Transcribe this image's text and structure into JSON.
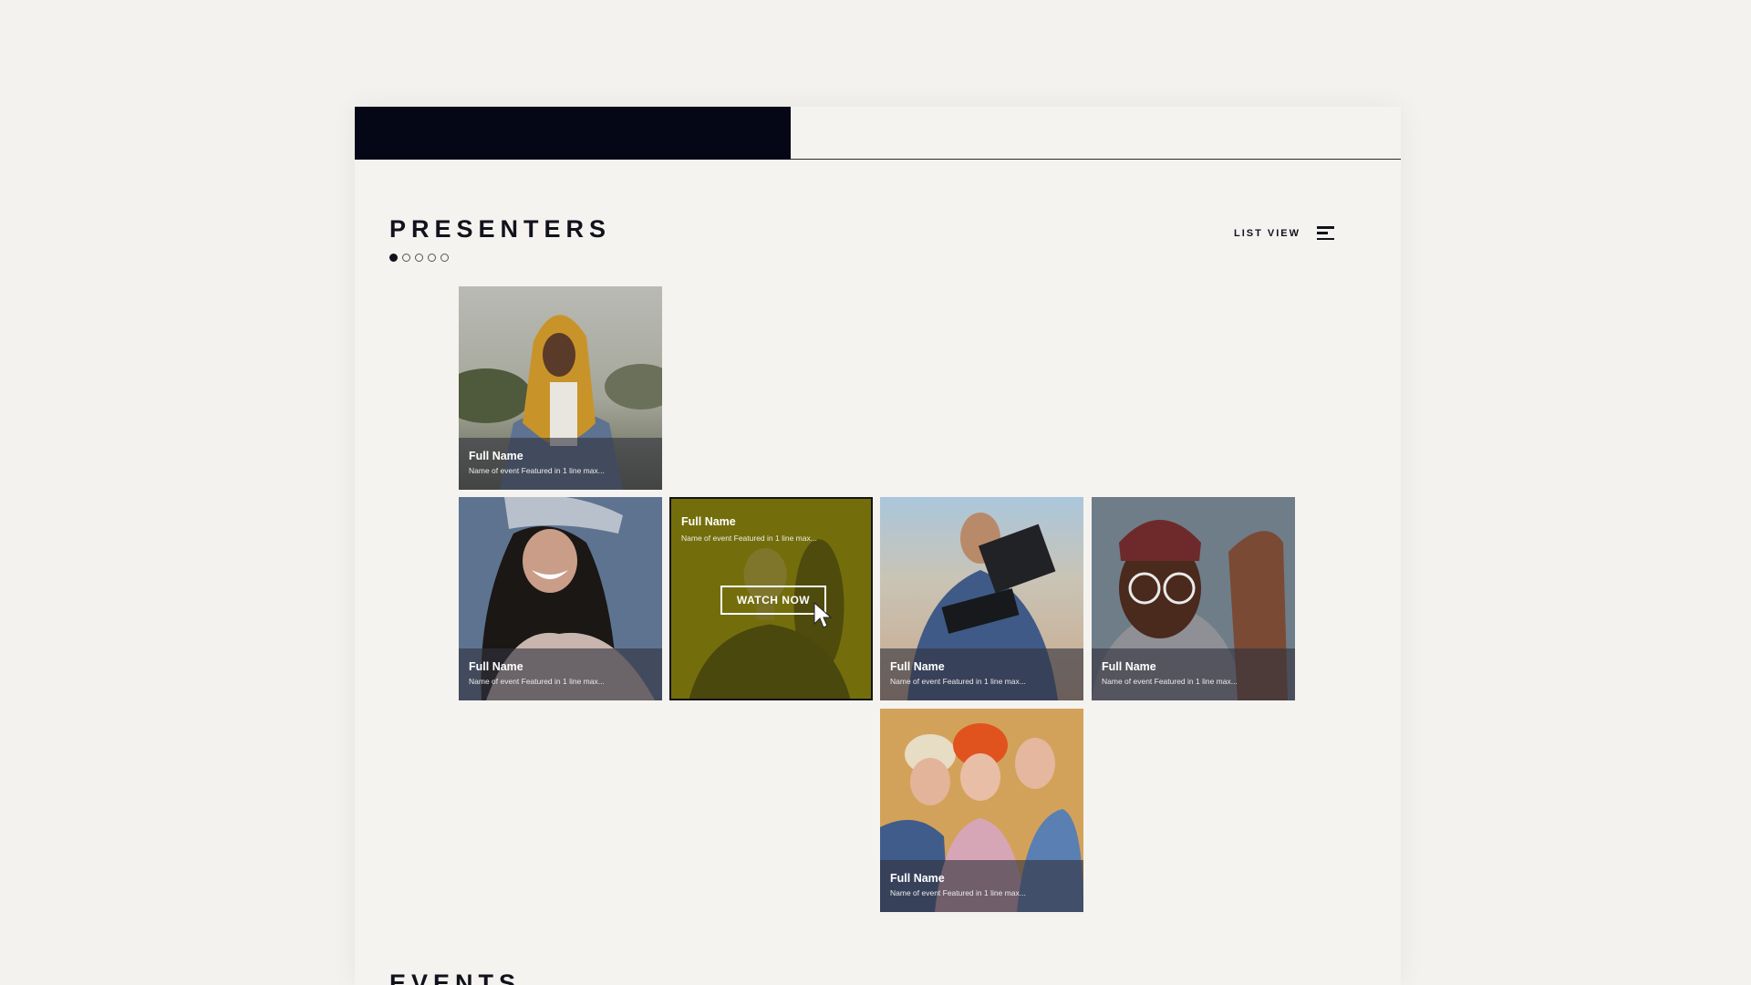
{
  "presenters": {
    "title": "PRESENTERS",
    "list_view_label": "LIST VIEW",
    "pagination_dots": 5,
    "active_dot": 1,
    "cards": [
      {
        "name": "Full Name",
        "event": "Name of event Featured in 1 line max..."
      },
      {
        "name": "Full Name",
        "event": "Name of event Featured in 1 line max..."
      },
      {
        "name": "Full Name",
        "event": "Name of event Featured in 1 line max...",
        "button": "WATCH NOW"
      },
      {
        "name": "Full Name",
        "event": "Name of event Featured in 1 line max..."
      },
      {
        "name": "Full Name",
        "event": "Name of event Featured in 1 line max..."
      },
      {
        "name": "Full Name",
        "event": "Name of event Featured in 1 line max..."
      }
    ]
  },
  "events": {
    "title": "EVENTS"
  },
  "colors": {
    "header_dark": "#050616",
    "hover_tint": "#787310"
  }
}
